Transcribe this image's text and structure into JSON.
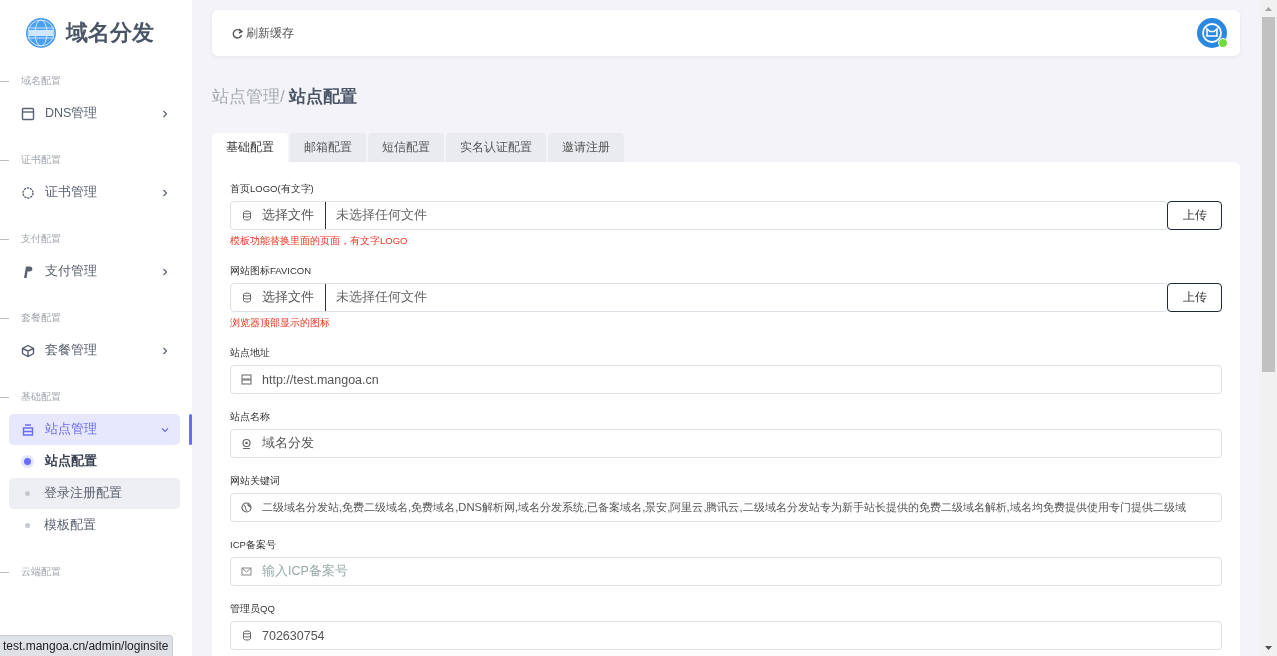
{
  "brand": {
    "title": "域名分发"
  },
  "sidebar": {
    "sections": [
      {
        "label": "域名配置",
        "items": [
          {
            "label": "DNS管理",
            "expanded": false,
            "selected": false
          }
        ]
      },
      {
        "label": "证书配置",
        "items": [
          {
            "label": "证书管理",
            "expanded": false,
            "selected": false
          }
        ]
      },
      {
        "label": "支付配置",
        "items": [
          {
            "label": "支付管理",
            "expanded": false,
            "selected": false
          }
        ]
      },
      {
        "label": "套餐配置",
        "items": [
          {
            "label": "套餐管理",
            "expanded": false,
            "selected": false
          }
        ]
      },
      {
        "label": "基础配置",
        "items": [
          {
            "label": "站点管理",
            "expanded": true,
            "selected": true,
            "children": [
              {
                "label": "站点配置",
                "selected": true,
                "hovered": false
              },
              {
                "label": "登录注册配置",
                "selected": false,
                "hovered": true
              },
              {
                "label": "模板配置",
                "selected": false,
                "hovered": false
              }
            ]
          }
        ]
      },
      {
        "label": "云端配置"
      }
    ]
  },
  "header": {
    "refresh": "刷新缓存",
    "user_online": true
  },
  "breadcrumb": {
    "parent": "站点管理/",
    "current": "站点配置"
  },
  "tabs": [
    {
      "label": "基础配置",
      "selected": true
    },
    {
      "label": "邮箱配置",
      "selected": false
    },
    {
      "label": "短信配置",
      "selected": false
    },
    {
      "label": "实名认证配置",
      "selected": false
    },
    {
      "label": "邀请注册",
      "selected": false
    }
  ],
  "form": {
    "fields": [
      {
        "kind": "file",
        "label": "首页LOGO(有文字)",
        "button": "选择文件",
        "status": "未选择任何文件",
        "upload": "上传",
        "hint": "模板功能替换里面的页面，有文字LOGO"
      },
      {
        "kind": "file",
        "label": "网站图标FAVICON",
        "button": "选择文件",
        "status": "未选择任何文件",
        "upload": "上传",
        "hint": "浏览器顶部显示的图标"
      },
      {
        "kind": "text",
        "label": "站点地址",
        "value": "http://test.mangoa.cn"
      },
      {
        "kind": "text",
        "label": "站点名称",
        "value": "域名分发"
      },
      {
        "kind": "text",
        "label": "网站关键词",
        "value": "二级域名分发站,免费二级域名,免费域名,DNS解析网,域名分发系统,已备案域名,景安,阿里云,腾讯云,二级域名分发站专为新手站长提供的免费二级域名解析,域名均免费提供使用专门提供二级域"
      },
      {
        "kind": "text",
        "label": "ICP备案号",
        "placeholder": "输入ICP备案号"
      },
      {
        "kind": "text",
        "label": "管理员QQ",
        "value": "702630754"
      }
    ]
  },
  "status_bar": {
    "url": "test.mangoa.cn/admin/loginsite"
  }
}
